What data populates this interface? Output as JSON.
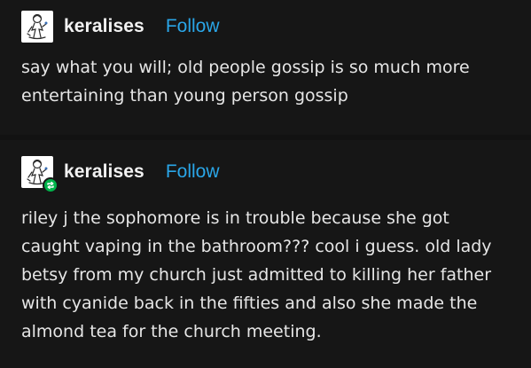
{
  "posts": [
    {
      "username": "keralises",
      "follow_label": "Follow",
      "avatar_icon": "sketch-avatar-icon",
      "text": "say what you will; old people gossip is so much more entertaining than young person gossip"
    },
    {
      "username": "keralises",
      "follow_label": "Follow",
      "avatar_icon": "sketch-avatar-icon",
      "badge_icon": "reblog-icon",
      "text": "riley j the sophomore is in trouble because she got caught vaping in the bathroom??? cool i guess. old lady betsy from my church just admitted to killing her father with cyanide back in the fifties and also she made the almond tea for the church meeting."
    }
  ],
  "colors": {
    "background": "#161616",
    "follow": "#2aa6e8",
    "reblog_badge": "#00b34a"
  }
}
